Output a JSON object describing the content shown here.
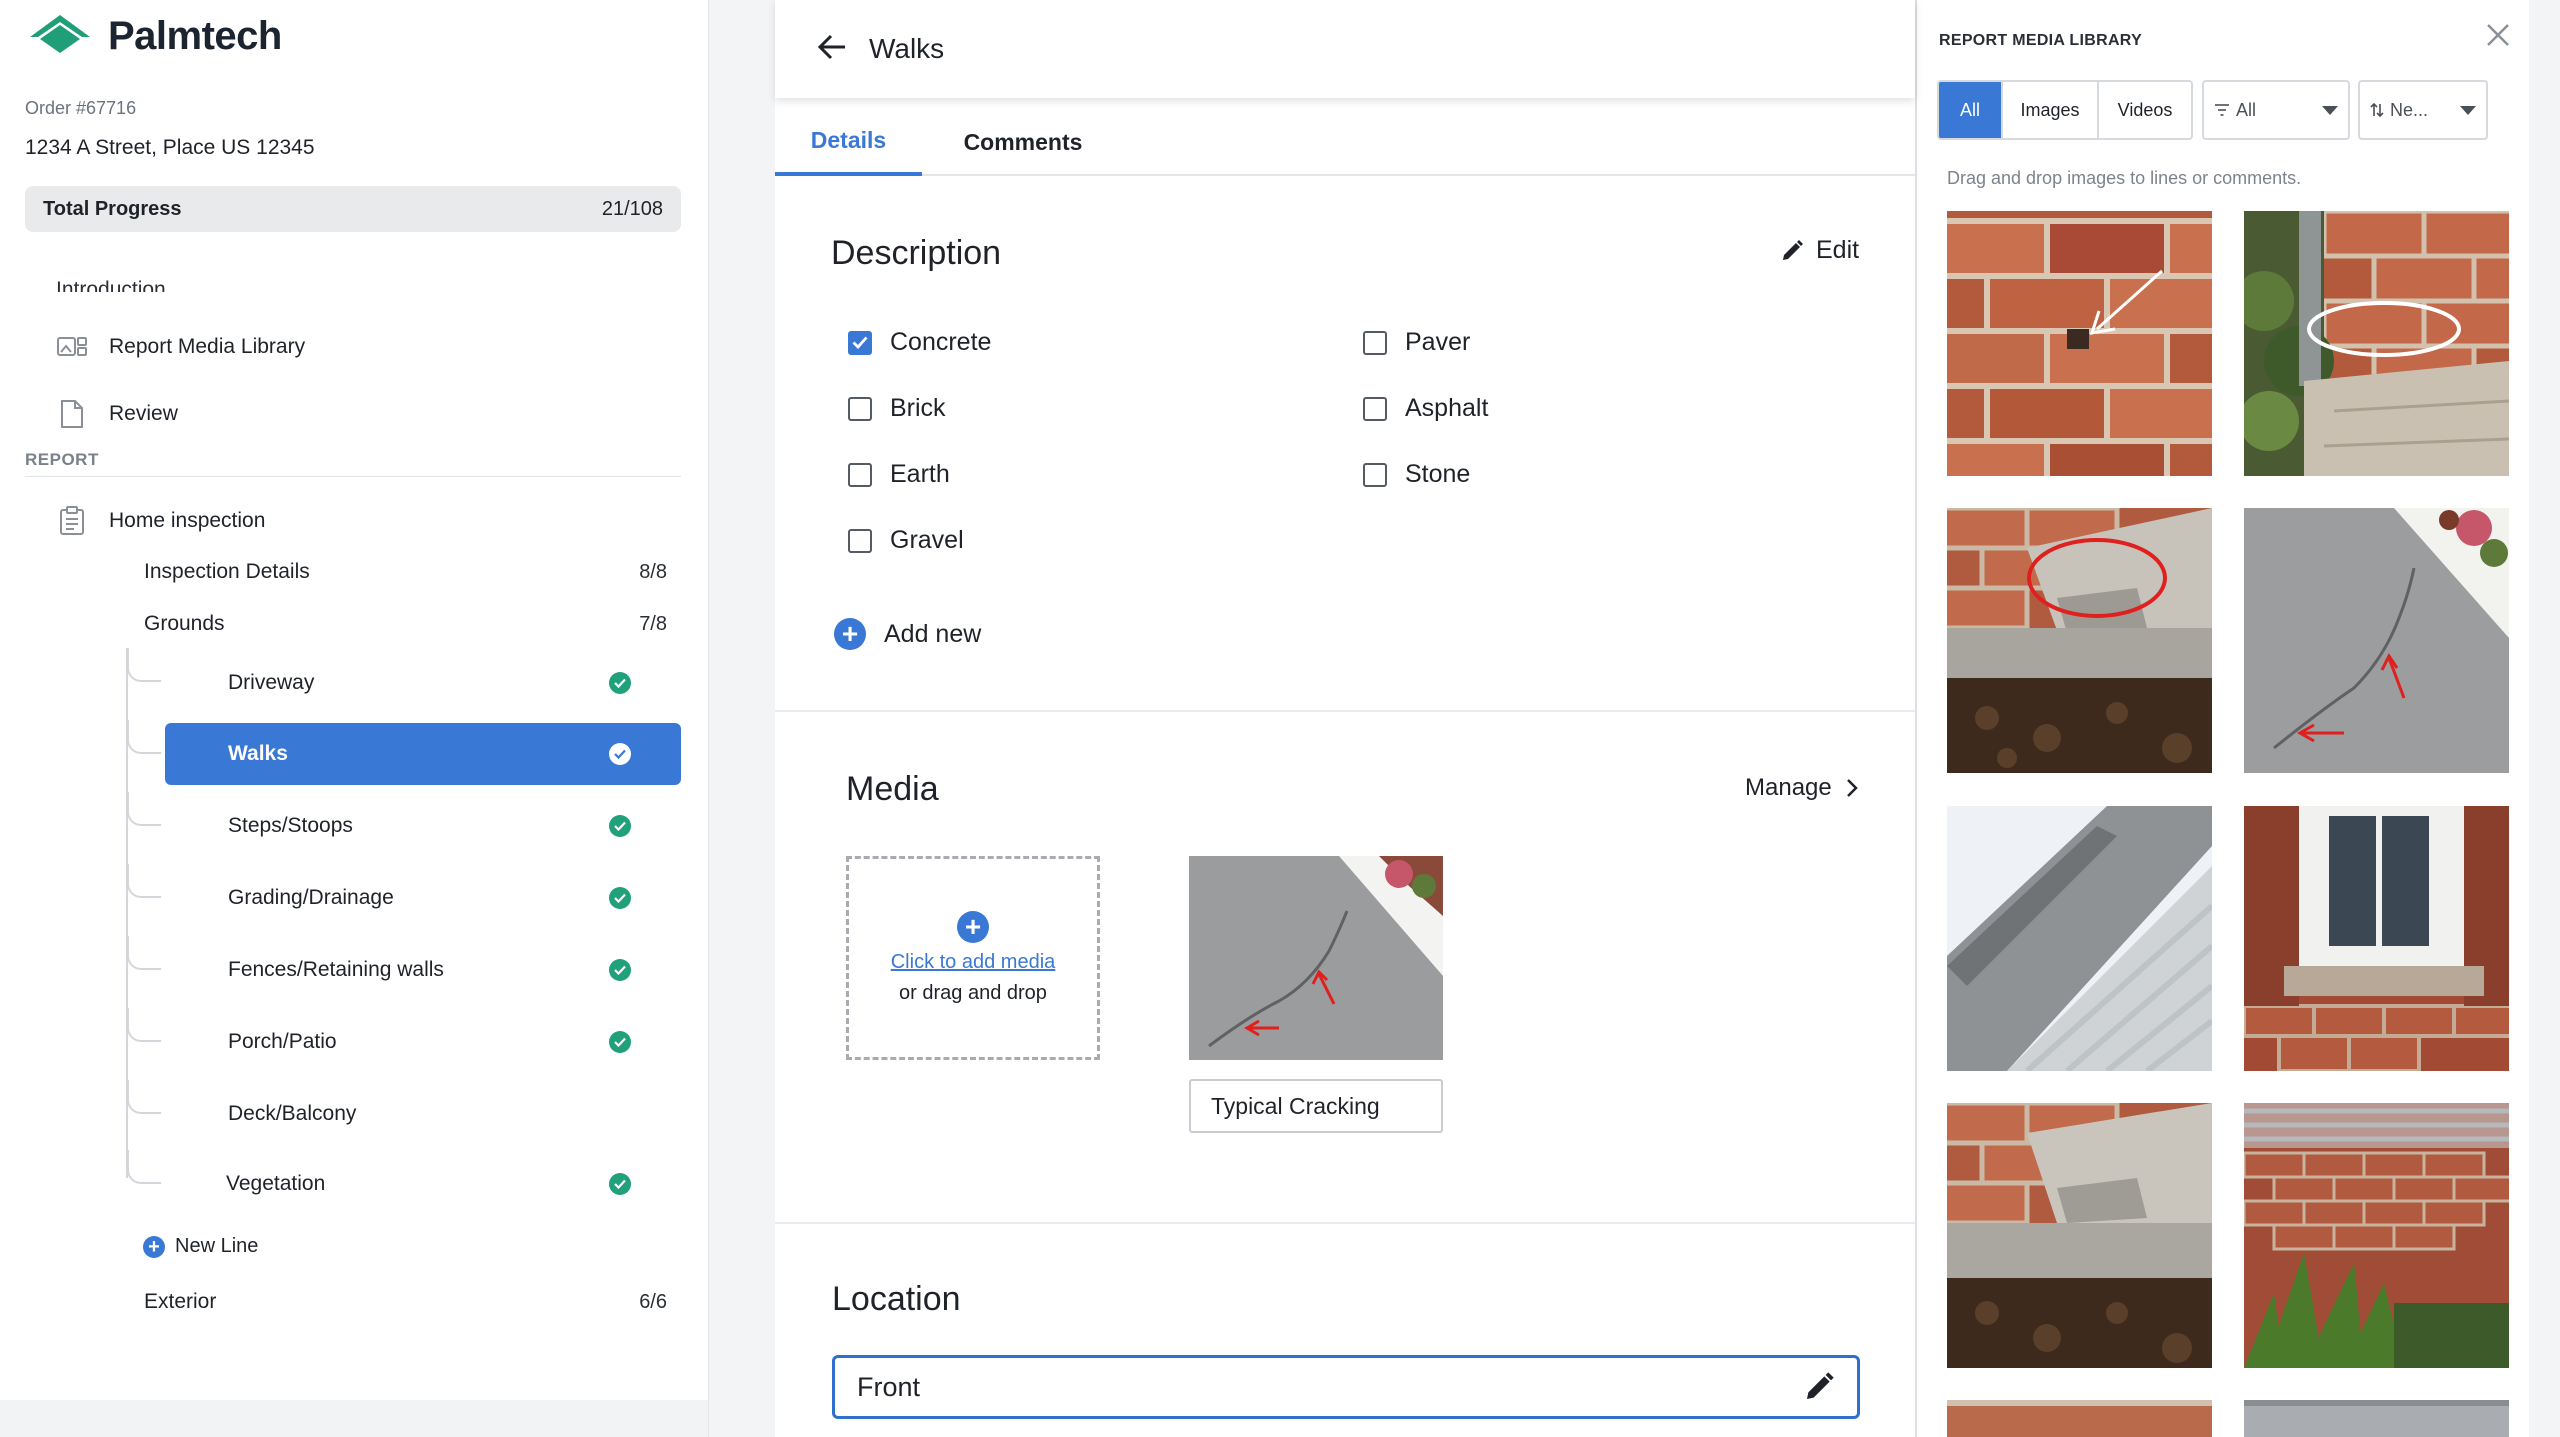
{
  "app": {
    "name": "Palmtech"
  },
  "order": {
    "number": "Order #67716",
    "address": "1234 A Street, Place US 12345"
  },
  "progress": {
    "label": "Total Progress",
    "count": "21/108"
  },
  "nav": {
    "cut_item": "Introduction",
    "items": [
      {
        "label": "Report Media Library",
        "icon": "media-library-icon"
      },
      {
        "label": "Review",
        "icon": "document-icon"
      }
    ]
  },
  "report": {
    "section_label": "REPORT",
    "root": {
      "label": "Home inspection",
      "icon": "clipboard-icon"
    },
    "groups": [
      {
        "label": "Inspection Details",
        "count": "8/8"
      },
      {
        "label": "Grounds",
        "count": "7/8"
      }
    ],
    "lines": [
      {
        "label": "Driveway",
        "complete": true
      },
      {
        "label": "Walks",
        "complete": true,
        "active": true
      },
      {
        "label": "Steps/Stoops",
        "complete": true
      },
      {
        "label": "Grading/Drainage",
        "complete": true
      },
      {
        "label": "Fences/Retaining walls",
        "complete": true
      },
      {
        "label": "Porch/Patio",
        "complete": true
      },
      {
        "label": "Deck/Balcony",
        "complete": false
      },
      {
        "label": "Vegetation",
        "complete": true
      }
    ],
    "new_line": "New Line",
    "after": {
      "label": "Exterior",
      "count": "6/6"
    }
  },
  "main": {
    "title": "Walks",
    "tabs": [
      {
        "label": "Details",
        "active": true
      },
      {
        "label": "Comments",
        "active": false
      }
    ],
    "description": {
      "title": "Description",
      "edit_label": "Edit",
      "options": [
        {
          "label": "Concrete",
          "checked": true
        },
        {
          "label": "Brick",
          "checked": false
        },
        {
          "label": "Earth",
          "checked": false
        },
        {
          "label": "Gravel",
          "checked": false
        },
        {
          "label": "Paver",
          "checked": false
        },
        {
          "label": "Asphalt",
          "checked": false
        },
        {
          "label": "Stone",
          "checked": false
        }
      ],
      "add_new": "Add new"
    },
    "media": {
      "title": "Media",
      "manage_label": "Manage",
      "dropzone_link": "Click to add media",
      "dropzone_sub": "or drag and drop",
      "caption": "Typical Cracking"
    },
    "location": {
      "title": "Location",
      "value": "Front"
    }
  },
  "panel": {
    "title": "REPORT MEDIA LIBRARY",
    "filters": [
      {
        "label": "All",
        "active": true
      },
      {
        "label": "Images",
        "active": false
      },
      {
        "label": "Videos",
        "active": false
      }
    ],
    "type_filter": "All",
    "sort": "Ne...",
    "hint": "Drag and drop images to lines or comments."
  },
  "colors": {
    "accent": "#3a78d6",
    "complete": "#21a07c",
    "logo": "#1f9e78"
  }
}
